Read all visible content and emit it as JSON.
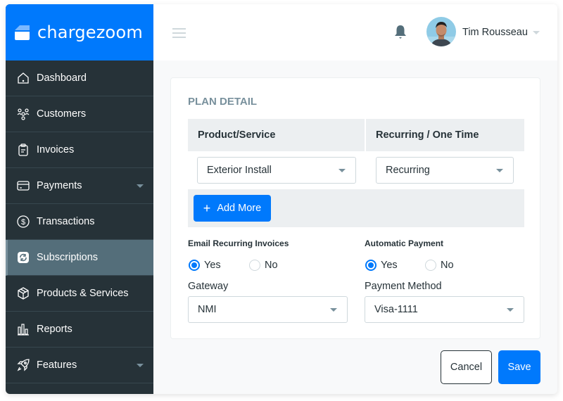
{
  "brand": {
    "name": "chargezoom",
    "color": "#0079fc"
  },
  "sidebar": {
    "items": [
      {
        "label": "Dashboard",
        "icon": "home-icon",
        "active": false,
        "has_submenu": false
      },
      {
        "label": "Customers",
        "icon": "customers-icon",
        "active": false,
        "has_submenu": false
      },
      {
        "label": "Invoices",
        "icon": "clipboard-icon",
        "active": false,
        "has_submenu": false
      },
      {
        "label": "Payments",
        "icon": "credit-card-icon",
        "active": false,
        "has_submenu": true
      },
      {
        "label": "Transactions",
        "icon": "dollar-circle-icon",
        "active": false,
        "has_submenu": false
      },
      {
        "label": "Subscriptions",
        "icon": "refresh-icon",
        "active": true,
        "has_submenu": false
      },
      {
        "label": "Products & Services",
        "icon": "box-icon",
        "active": false,
        "has_submenu": false
      },
      {
        "label": "Reports",
        "icon": "bar-chart-icon",
        "active": false,
        "has_submenu": false
      },
      {
        "label": "Features",
        "icon": "rocket-icon",
        "active": false,
        "has_submenu": true
      }
    ]
  },
  "header": {
    "user_name": "Tim Rousseau",
    "notification_icon": "bell-icon",
    "menu_icon": "hamburger-icon"
  },
  "plan": {
    "title": "PLAN DETAIL",
    "columns": [
      "Product/Service",
      "Recurring / One Time"
    ],
    "rows": [
      {
        "product": "Exterior Install",
        "frequency": "Recurring"
      }
    ],
    "add_more_label": "Add More",
    "email_recurring": {
      "label": "Email Recurring Invoices",
      "options": [
        "Yes",
        "No"
      ],
      "selected": "Yes"
    },
    "automatic_payment": {
      "label": "Automatic Payment",
      "options": [
        "Yes",
        "No"
      ],
      "selected": "Yes"
    },
    "gateway": {
      "label": "Gateway",
      "value": "NMI"
    },
    "payment_method": {
      "label": "Payment Method",
      "value": "Visa-1111"
    }
  },
  "actions": {
    "cancel_label": "Cancel",
    "save_label": "Save"
  }
}
